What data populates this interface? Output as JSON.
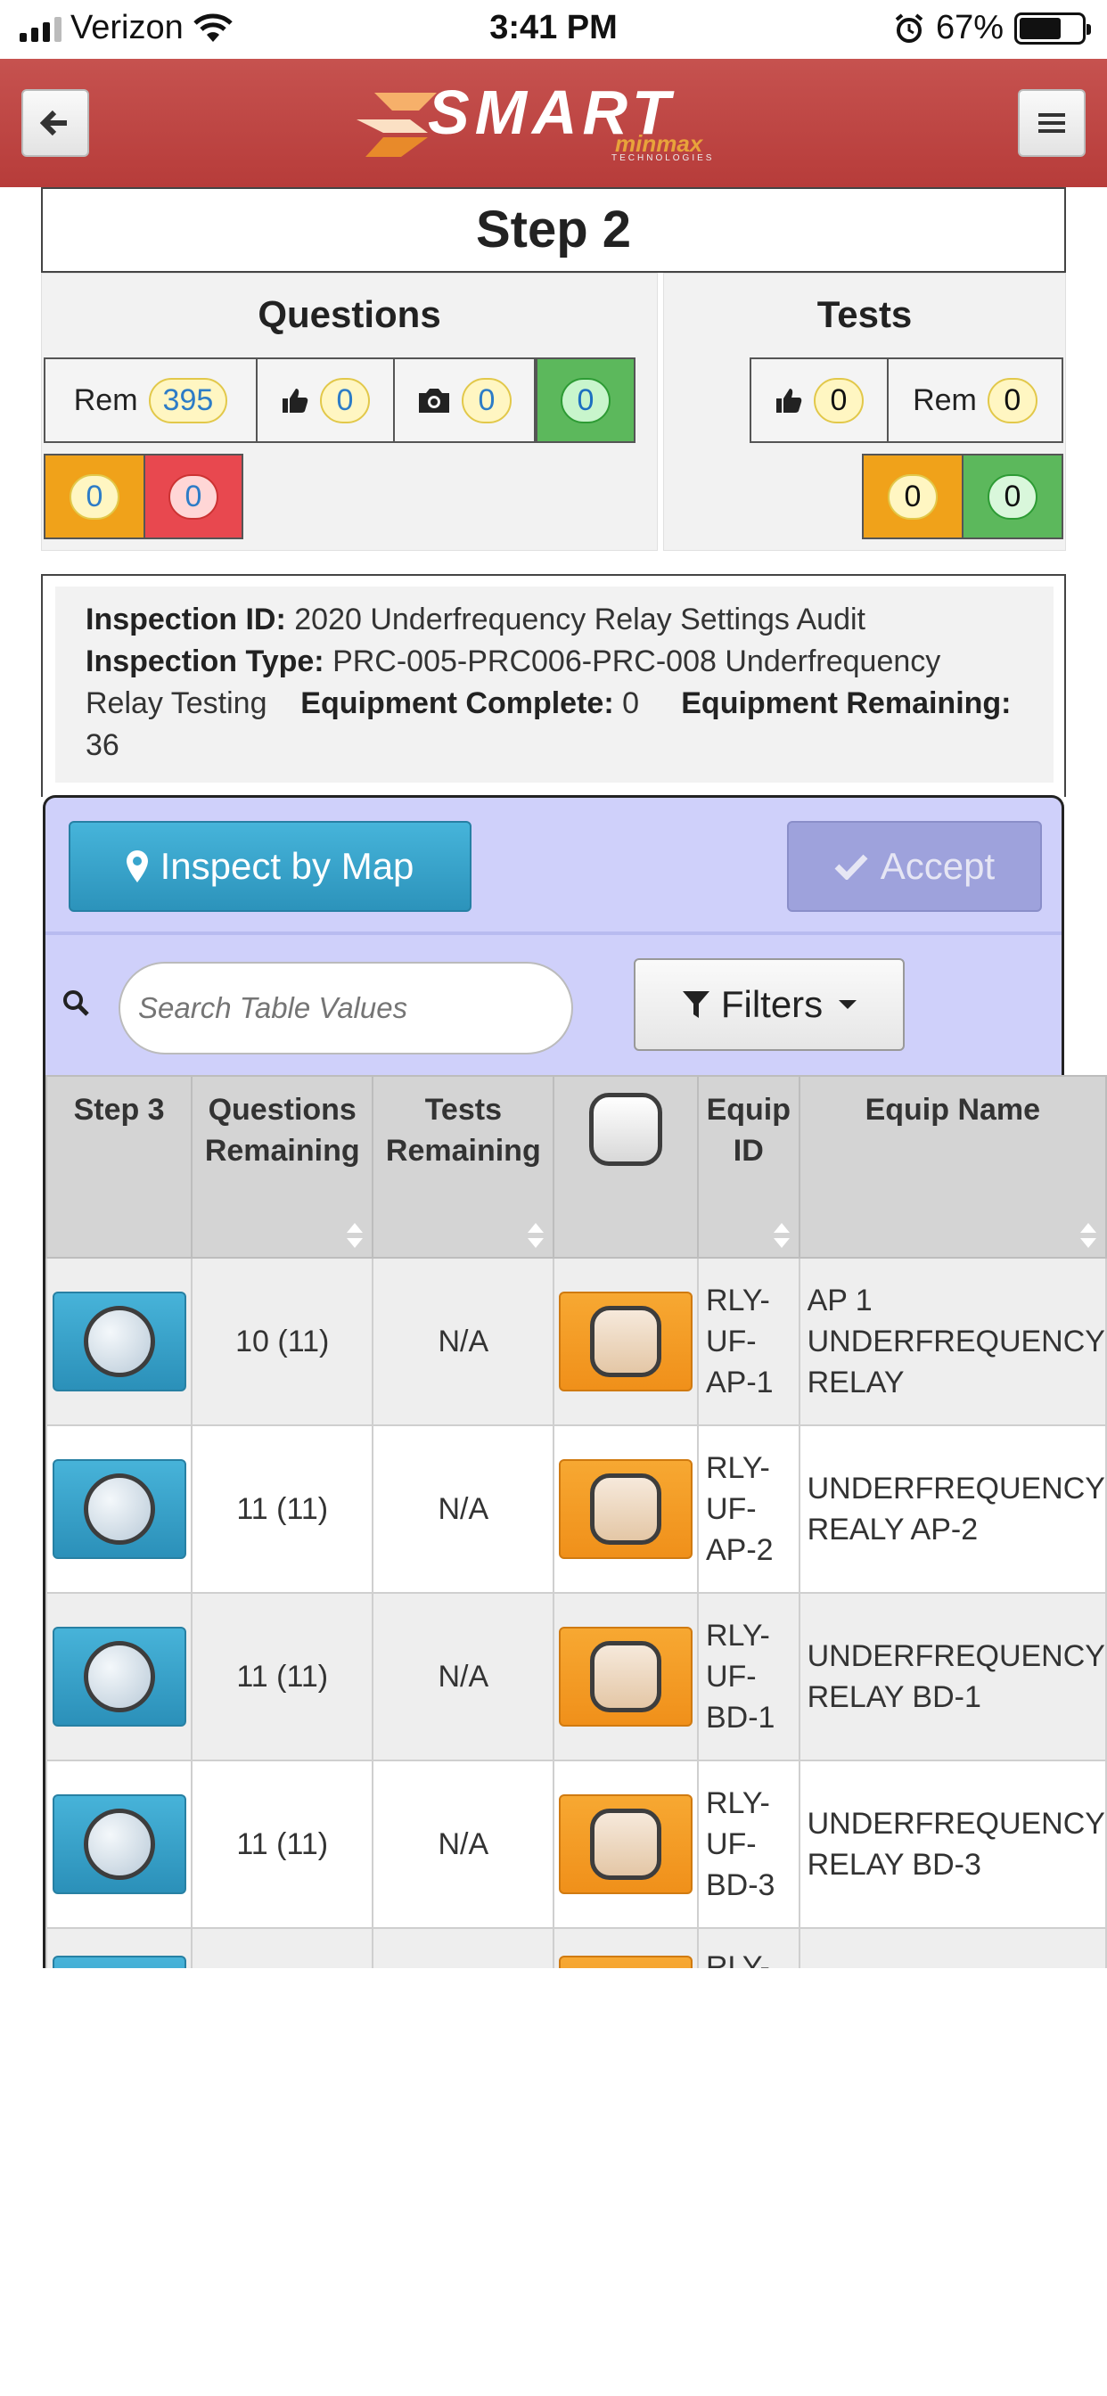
{
  "status_bar": {
    "carrier": "Verizon",
    "time": "3:41 PM",
    "battery": "67%",
    "battery_level": 0.67
  },
  "header": {
    "logo_text": "SMART",
    "logo_sub": "minmax",
    "logo_tiny": "TECHNOLOGIES",
    "back_icon": "arrow-left-icon",
    "menu_icon": "hamburger-menu-icon",
    "brand_color": "#b73c3a"
  },
  "step_title": "Step 2",
  "questions": {
    "title": "Questions",
    "rem_label": "Rem",
    "rem_value": "395",
    "thumbs_value": "0",
    "camera_value": "0",
    "green_value": "0",
    "orange_value": "0",
    "red_value": "0"
  },
  "tests": {
    "title": "Tests",
    "thumbs_value": "0",
    "rem_label": "Rem",
    "rem_value": "0",
    "orange_value": "0",
    "green_value": "0"
  },
  "info": {
    "inspection_id_label": "Inspection ID:",
    "inspection_id": "2020 Underfrequency Relay Settings Audit",
    "inspection_type_label": "Inspection Type:",
    "inspection_type": "PRC-005-PRC006-PRC-008 Underfrequency Relay Testing",
    "equipment_complete_label": "Equipment Complete:",
    "equipment_complete": "0",
    "equipment_remaining_label_1": "Equipment",
    "equipment_remaining_label_2": "Remaining:",
    "equipment_remaining": "36"
  },
  "actions": {
    "inspect_by_map": "Inspect by Map",
    "accept": "Accept",
    "search_placeholder": "Search Table Values",
    "filters": "Filters"
  },
  "table": {
    "headers": {
      "step3": "Step 3",
      "questions_remaining_1": "Questions",
      "questions_remaining_2": "Remaining",
      "tests_remaining_1": "Tests",
      "tests_remaining_2": "Remaining",
      "equip_id_1": "Equip",
      "equip_id_2": "ID",
      "equip_name": "Equip Name"
    },
    "rows": [
      {
        "questions": "10 (11)",
        "tests": "N/A",
        "id1": "RLY-",
        "id2": "UF-",
        "id3": "AP-1",
        "name1": "AP 1",
        "name2": "UNDERFREQUENCY",
        "name3": "RELAY"
      },
      {
        "questions": "11 (11)",
        "tests": "N/A",
        "id1": "RLY-",
        "id2": "UF-",
        "id3": "AP-2",
        "name1": "UNDERFREQUENCY",
        "name2": "REALY AP-2",
        "name3": ""
      },
      {
        "questions": "11 (11)",
        "tests": "N/A",
        "id1": "RLY-",
        "id2": "UF-",
        "id3": "BD-1",
        "name1": "UNDERFREQUENCY",
        "name2": "RELAY BD-1",
        "name3": ""
      },
      {
        "questions": "11 (11)",
        "tests": "N/A",
        "id1": "RLY-",
        "id2": "UF-",
        "id3": "BD-3",
        "name1": "UNDERFREQUENCY",
        "name2": "RELAY BD-3",
        "name3": ""
      }
    ],
    "partial_row_id": "RLY-"
  }
}
